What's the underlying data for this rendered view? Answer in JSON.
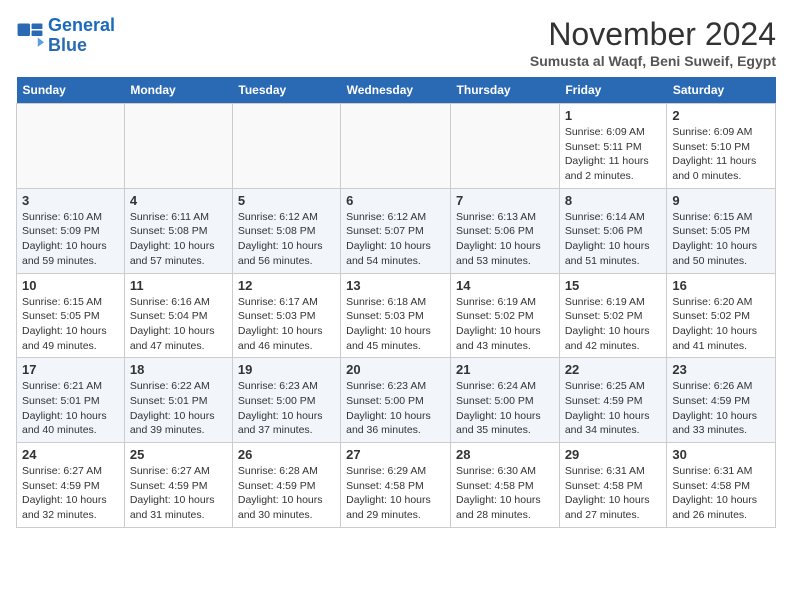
{
  "logo": {
    "line1": "General",
    "line2": "Blue"
  },
  "title": "November 2024",
  "location": "Sumusta al Waqf, Beni Suweif, Egypt",
  "weekdays": [
    "Sunday",
    "Monday",
    "Tuesday",
    "Wednesday",
    "Thursday",
    "Friday",
    "Saturday"
  ],
  "weeks": [
    [
      {
        "day": "",
        "info": ""
      },
      {
        "day": "",
        "info": ""
      },
      {
        "day": "",
        "info": ""
      },
      {
        "day": "",
        "info": ""
      },
      {
        "day": "",
        "info": ""
      },
      {
        "day": "1",
        "info": "Sunrise: 6:09 AM\nSunset: 5:11 PM\nDaylight: 11 hours\nand 2 minutes."
      },
      {
        "day": "2",
        "info": "Sunrise: 6:09 AM\nSunset: 5:10 PM\nDaylight: 11 hours\nand 0 minutes."
      }
    ],
    [
      {
        "day": "3",
        "info": "Sunrise: 6:10 AM\nSunset: 5:09 PM\nDaylight: 10 hours\nand 59 minutes."
      },
      {
        "day": "4",
        "info": "Sunrise: 6:11 AM\nSunset: 5:08 PM\nDaylight: 10 hours\nand 57 minutes."
      },
      {
        "day": "5",
        "info": "Sunrise: 6:12 AM\nSunset: 5:08 PM\nDaylight: 10 hours\nand 56 minutes."
      },
      {
        "day": "6",
        "info": "Sunrise: 6:12 AM\nSunset: 5:07 PM\nDaylight: 10 hours\nand 54 minutes."
      },
      {
        "day": "7",
        "info": "Sunrise: 6:13 AM\nSunset: 5:06 PM\nDaylight: 10 hours\nand 53 minutes."
      },
      {
        "day": "8",
        "info": "Sunrise: 6:14 AM\nSunset: 5:06 PM\nDaylight: 10 hours\nand 51 minutes."
      },
      {
        "day": "9",
        "info": "Sunrise: 6:15 AM\nSunset: 5:05 PM\nDaylight: 10 hours\nand 50 minutes."
      }
    ],
    [
      {
        "day": "10",
        "info": "Sunrise: 6:15 AM\nSunset: 5:05 PM\nDaylight: 10 hours\nand 49 minutes."
      },
      {
        "day": "11",
        "info": "Sunrise: 6:16 AM\nSunset: 5:04 PM\nDaylight: 10 hours\nand 47 minutes."
      },
      {
        "day": "12",
        "info": "Sunrise: 6:17 AM\nSunset: 5:03 PM\nDaylight: 10 hours\nand 46 minutes."
      },
      {
        "day": "13",
        "info": "Sunrise: 6:18 AM\nSunset: 5:03 PM\nDaylight: 10 hours\nand 45 minutes."
      },
      {
        "day": "14",
        "info": "Sunrise: 6:19 AM\nSunset: 5:02 PM\nDaylight: 10 hours\nand 43 minutes."
      },
      {
        "day": "15",
        "info": "Sunrise: 6:19 AM\nSunset: 5:02 PM\nDaylight: 10 hours\nand 42 minutes."
      },
      {
        "day": "16",
        "info": "Sunrise: 6:20 AM\nSunset: 5:02 PM\nDaylight: 10 hours\nand 41 minutes."
      }
    ],
    [
      {
        "day": "17",
        "info": "Sunrise: 6:21 AM\nSunset: 5:01 PM\nDaylight: 10 hours\nand 40 minutes."
      },
      {
        "day": "18",
        "info": "Sunrise: 6:22 AM\nSunset: 5:01 PM\nDaylight: 10 hours\nand 39 minutes."
      },
      {
        "day": "19",
        "info": "Sunrise: 6:23 AM\nSunset: 5:00 PM\nDaylight: 10 hours\nand 37 minutes."
      },
      {
        "day": "20",
        "info": "Sunrise: 6:23 AM\nSunset: 5:00 PM\nDaylight: 10 hours\nand 36 minutes."
      },
      {
        "day": "21",
        "info": "Sunrise: 6:24 AM\nSunset: 5:00 PM\nDaylight: 10 hours\nand 35 minutes."
      },
      {
        "day": "22",
        "info": "Sunrise: 6:25 AM\nSunset: 4:59 PM\nDaylight: 10 hours\nand 34 minutes."
      },
      {
        "day": "23",
        "info": "Sunrise: 6:26 AM\nSunset: 4:59 PM\nDaylight: 10 hours\nand 33 minutes."
      }
    ],
    [
      {
        "day": "24",
        "info": "Sunrise: 6:27 AM\nSunset: 4:59 PM\nDaylight: 10 hours\nand 32 minutes."
      },
      {
        "day": "25",
        "info": "Sunrise: 6:27 AM\nSunset: 4:59 PM\nDaylight: 10 hours\nand 31 minutes."
      },
      {
        "day": "26",
        "info": "Sunrise: 6:28 AM\nSunset: 4:59 PM\nDaylight: 10 hours\nand 30 minutes."
      },
      {
        "day": "27",
        "info": "Sunrise: 6:29 AM\nSunset: 4:58 PM\nDaylight: 10 hours\nand 29 minutes."
      },
      {
        "day": "28",
        "info": "Sunrise: 6:30 AM\nSunset: 4:58 PM\nDaylight: 10 hours\nand 28 minutes."
      },
      {
        "day": "29",
        "info": "Sunrise: 6:31 AM\nSunset: 4:58 PM\nDaylight: 10 hours\nand 27 minutes."
      },
      {
        "day": "30",
        "info": "Sunrise: 6:31 AM\nSunset: 4:58 PM\nDaylight: 10 hours\nand 26 minutes."
      }
    ]
  ]
}
